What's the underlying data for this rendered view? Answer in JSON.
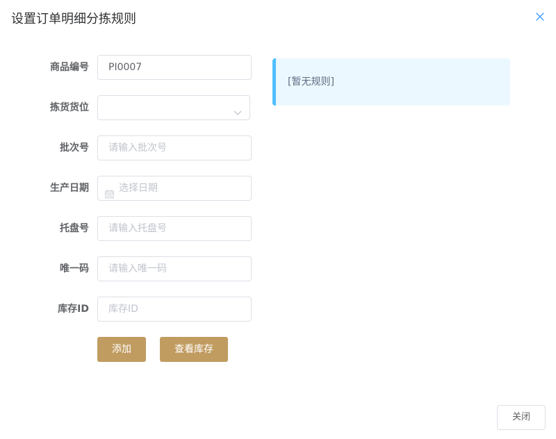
{
  "dialog": {
    "title": "设置订单明细分拣规则",
    "close_icon": "close-icon"
  },
  "form": {
    "product_code": {
      "label": "商品编号",
      "value": "PI0007",
      "placeholder": ""
    },
    "pick_location": {
      "label": "拣货货位",
      "value": "",
      "placeholder": ""
    },
    "batch_no": {
      "label": "批次号",
      "value": "",
      "placeholder": "请输入批次号"
    },
    "production_date": {
      "label": "生产日期",
      "value": "",
      "placeholder": "选择日期",
      "icon": "calendar-icon"
    },
    "pallet_no": {
      "label": "托盘号",
      "value": "",
      "placeholder": "请输入托盘号"
    },
    "unique_code": {
      "label": "唯一码",
      "value": "",
      "placeholder": "请输入唯一码"
    },
    "stock_id": {
      "label": "库存ID",
      "value": "",
      "placeholder": "库存ID"
    }
  },
  "buttons": {
    "add": "添加",
    "view_stock": "查看库存",
    "close": "关闭"
  },
  "rules": {
    "empty_text": "[暂无规则]"
  },
  "colors": {
    "primary_button": "#c19c61",
    "rule_box_bg": "#ecf8ff",
    "rule_box_border": "#50bfff"
  }
}
